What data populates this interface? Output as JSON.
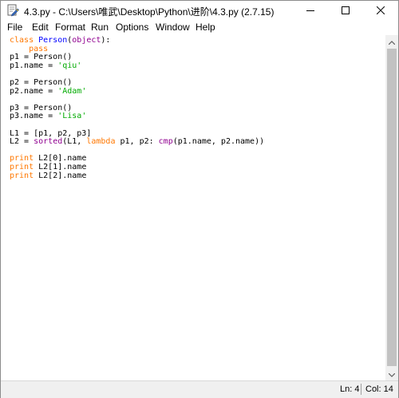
{
  "window": {
    "title": "4.3.py - C:\\Users\\唯武\\Desktop\\Python\\进阶\\4.3.py (2.7.15)"
  },
  "menu": {
    "items": [
      "File",
      "Edit",
      "Format",
      "Run",
      "Options",
      "Window",
      "Help"
    ]
  },
  "editor": {
    "lines": [
      [
        {
          "t": "class ",
          "c": "kw"
        },
        {
          "t": "Person",
          "c": "def"
        },
        {
          "t": "(",
          "c": "plain"
        },
        {
          "t": "object",
          "c": "builtin"
        },
        {
          "t": "):",
          "c": "plain"
        }
      ],
      [
        {
          "t": "    pass",
          "c": "kw"
        }
      ],
      [
        {
          "t": "p1 = Person()",
          "c": "plain"
        }
      ],
      [
        {
          "t": "p1.name = ",
          "c": "plain"
        },
        {
          "t": "'qiu'",
          "c": "str"
        }
      ],
      [],
      [
        {
          "t": "p2 = Person()",
          "c": "plain"
        }
      ],
      [
        {
          "t": "p2.name = ",
          "c": "plain"
        },
        {
          "t": "'Adam'",
          "c": "str"
        }
      ],
      [],
      [
        {
          "t": "p3 = Person()",
          "c": "plain"
        }
      ],
      [
        {
          "t": "p3.name = ",
          "c": "plain"
        },
        {
          "t": "'Lisa'",
          "c": "str"
        }
      ],
      [],
      [
        {
          "t": "L1 = [p1, p2, p3]",
          "c": "plain"
        }
      ],
      [
        {
          "t": "L2 = ",
          "c": "plain"
        },
        {
          "t": "sorted",
          "c": "builtin"
        },
        {
          "t": "(L1, ",
          "c": "plain"
        },
        {
          "t": "lambda",
          "c": "kw"
        },
        {
          "t": " p1, p2: ",
          "c": "plain"
        },
        {
          "t": "cmp",
          "c": "builtin"
        },
        {
          "t": "(p1.name, p2.name))",
          "c": "plain"
        }
      ],
      [],
      [
        {
          "t": "print",
          "c": "kw"
        },
        {
          "t": " L2[0].name",
          "c": "plain"
        }
      ],
      [
        {
          "t": "print",
          "c": "kw"
        },
        {
          "t": " L2[1].name",
          "c": "plain"
        }
      ],
      [
        {
          "t": "print",
          "c": "kw"
        },
        {
          "t": " L2[2].name",
          "c": "plain"
        }
      ]
    ]
  },
  "status": {
    "line": "Ln: 4",
    "col": "Col: 14"
  },
  "colors": {
    "keyword": "#ff7700",
    "definition": "#0000ff",
    "builtin": "#900090",
    "string": "#00aa00"
  },
  "icons": {
    "app": "idle-editor-icon",
    "minimize": "minimize-icon",
    "maximize": "maximize-icon",
    "close": "close-icon"
  }
}
